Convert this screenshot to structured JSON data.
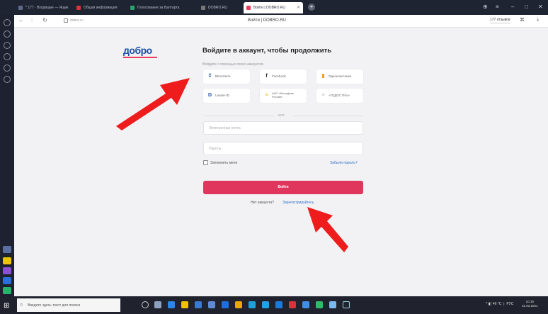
{
  "browser": {
    "tabs": [
      {
        "label": "* 177 · Входящие — Ящик",
        "color": "#5d6b8a",
        "active": false
      },
      {
        "label": "Общая информация",
        "color": "#d33",
        "active": false
      },
      {
        "label": "Голосование за Балтарта",
        "color": "#2aa36b",
        "active": false
      },
      {
        "label": "DOBRO.RU",
        "color": "#777",
        "active": false
      },
      {
        "label": "Войти | DOBRO.RU",
        "color": "#ec3b5c",
        "active": true
      }
    ],
    "page_title": "Войти | DOBRO.RU",
    "url": "dobro.ru",
    "reviews_badge": "177 отзывов"
  },
  "login": {
    "logo": "добро",
    "heading": "Войдите в аккаунт, чтобы продолжить",
    "social_hint": "Войдите с помощью своих аккаунтов",
    "social": [
      {
        "label": "ВКонтакте",
        "icon": "vk-icon",
        "glyph": "ʬ",
        "color": "#4a76a8"
      },
      {
        "label": "Facebook",
        "icon": "facebook-icon",
        "glyph": "f",
        "color": "#222"
      },
      {
        "label": "Одноклассники",
        "icon": "ok-icon",
        "glyph": "▮",
        "color": "#f7931e"
      },
      {
        "label": "Leader-ID",
        "icon": "leader-id-icon",
        "glyph": "D",
        "color": "#1e4aa8"
      },
      {
        "label": "АИС «Молодёжь России»",
        "icon": "ais-icon",
        "glyph": "≡",
        "color": "#e6b800"
      },
      {
        "label": "«ГОДОС Пбо»",
        "icon": "godos-icon",
        "glyph": "≡",
        "color": "#bbb"
      }
    ],
    "or_label": "или",
    "email_placeholder": "Электронная почта",
    "password_placeholder": "Пароль",
    "remember_label": "Запомнить меня",
    "forgot_link": "Забыли пароль?",
    "submit_label": "Войти",
    "no_account": "Нет аккаунта?",
    "register_link": "Зарегистрируйтесь"
  },
  "taskbar": {
    "search_placeholder": "Введите здесь текст для поиска",
    "tray": "^ ◧ 46 °C ❘ РУС",
    "time": "10:18",
    "date": "31.03.2021"
  }
}
